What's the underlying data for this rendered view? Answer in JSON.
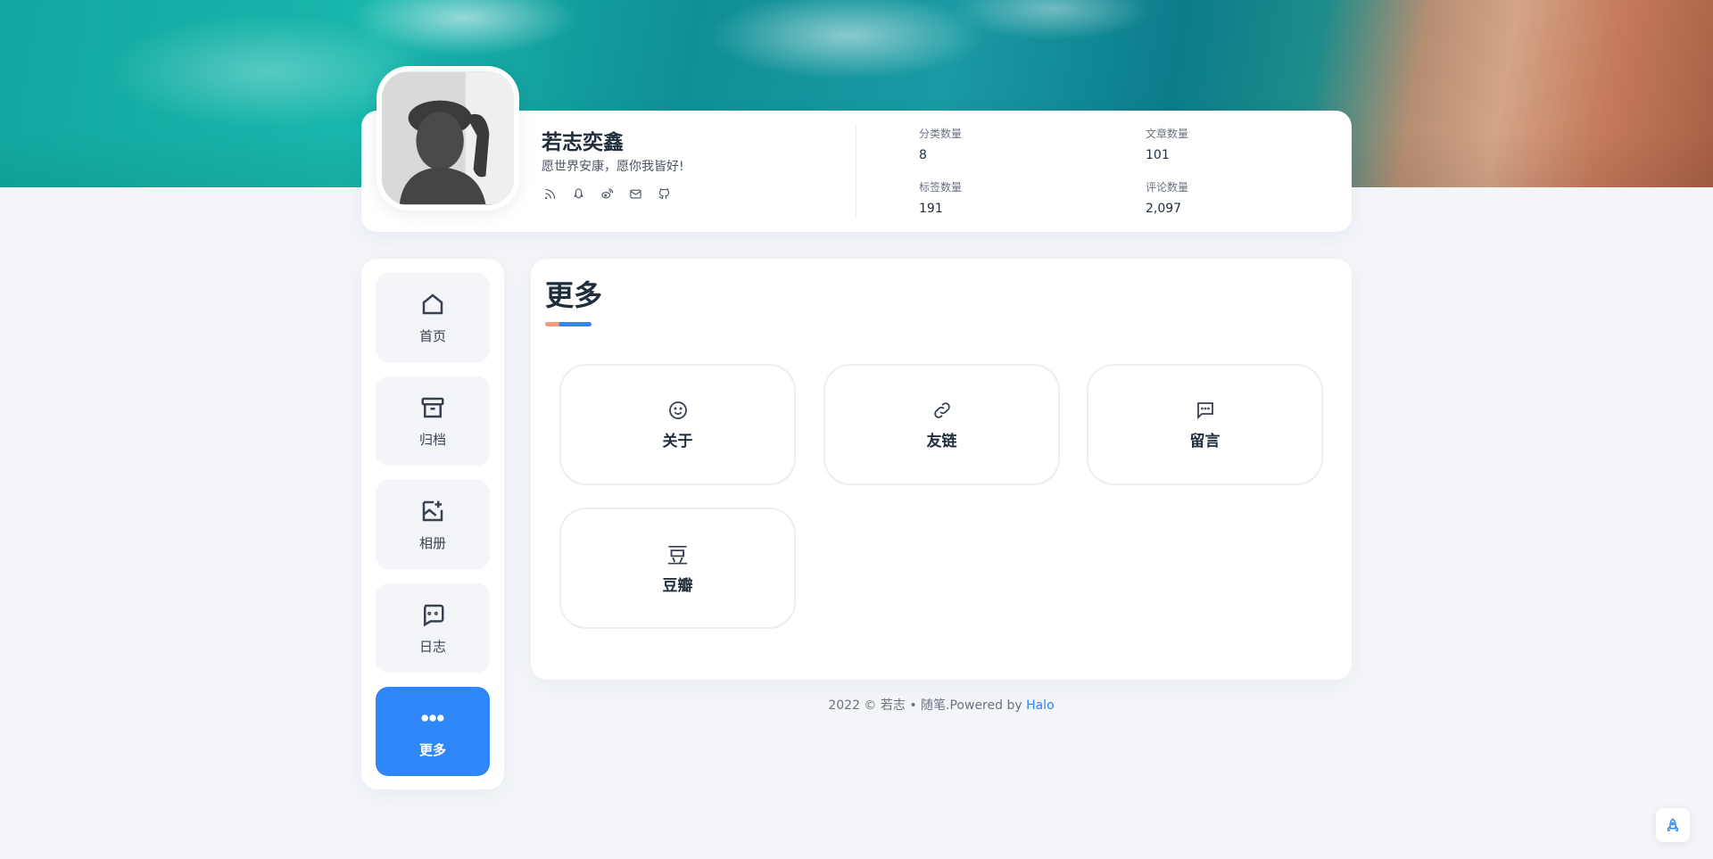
{
  "profile": {
    "name": "若志奕鑫",
    "motto": "愿世界安康，愿你我皆好!",
    "social_icons": [
      "rss-icon",
      "qq-icon",
      "weibo-icon",
      "mail-icon",
      "github-icon"
    ],
    "stats": [
      {
        "label": "分类数量",
        "value": "8"
      },
      {
        "label": "文章数量",
        "value": "101"
      },
      {
        "label": "标签数量",
        "value": "191"
      },
      {
        "label": "评论数量",
        "value": "2,097"
      }
    ]
  },
  "nav": {
    "items": [
      {
        "label": "首页",
        "icon": "home-icon"
      },
      {
        "label": "归档",
        "icon": "archive-icon"
      },
      {
        "label": "相册",
        "icon": "photo-icon"
      },
      {
        "label": "日志",
        "icon": "journal-icon"
      },
      {
        "label": "更多",
        "icon": "more-icon",
        "active": true
      }
    ]
  },
  "main": {
    "title": "更多",
    "tiles": [
      {
        "label": "关于",
        "icon": "smile-icon"
      },
      {
        "label": "友链",
        "icon": "link-icon"
      },
      {
        "label": "留言",
        "icon": "message-icon"
      },
      {
        "label": "豆瓣",
        "glyph": "豆"
      }
    ]
  },
  "footer": {
    "text": "2022 © 若志 • 随笔.Powered by ",
    "link": "Halo"
  },
  "colors": {
    "accent": "#2f86f6",
    "title_bar_orange": "#f59a7c"
  }
}
